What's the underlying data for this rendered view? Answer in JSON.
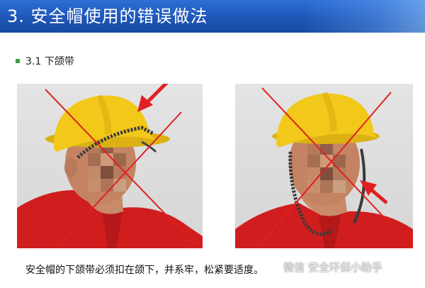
{
  "slide": {
    "title": "3. 安全帽使用的错误做法",
    "section": "3.1  下颌带",
    "caption": "安全帽的下颌带必须扣在颌下，并系牢，松紧要适度。",
    "watermark": "微信 安全环保小助手"
  },
  "colors": {
    "title_bar": "#1f56b8",
    "title_text": "#ffffff",
    "bullet": "#3aa14a",
    "cross": "#e02020",
    "helmet": "#f2c81a",
    "jacket": "#d01e1e"
  },
  "photos": [
    {
      "name": "photo-wrong-strap-above-chin",
      "icon": "cross-mark-icon"
    },
    {
      "name": "photo-wrong-strap-loose",
      "icon": "cross-mark-icon"
    }
  ]
}
